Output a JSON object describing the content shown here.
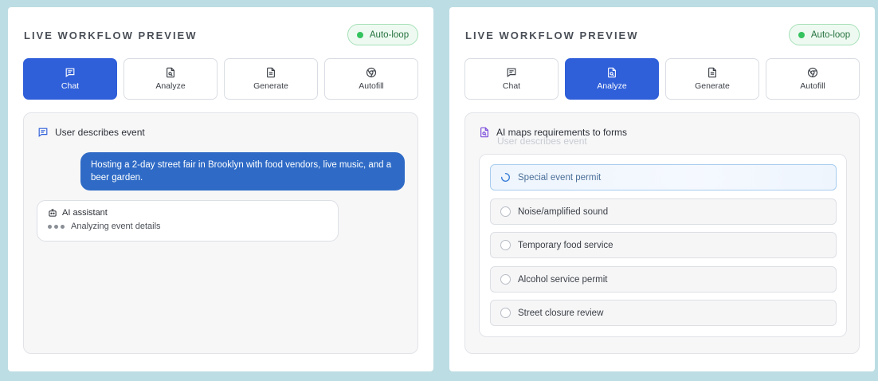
{
  "panels": [
    {
      "title": "LIVE WORKFLOW PREVIEW",
      "badge": "Auto-loop",
      "tabs": [
        {
          "label": "Chat"
        },
        {
          "label": "Analyze"
        },
        {
          "label": "Generate"
        },
        {
          "label": "Autofill"
        }
      ],
      "active_tab": "Chat",
      "step_title": "User describes event",
      "user_message": "Hosting a 2-day street fair in Brooklyn with food vendors, live music, and a beer garden.",
      "assistant_name": "AI assistant",
      "assistant_status": "Analyzing event details"
    },
    {
      "title": "LIVE WORKFLOW PREVIEW",
      "badge": "Auto-loop",
      "tabs": [
        {
          "label": "Chat"
        },
        {
          "label": "Analyze"
        },
        {
          "label": "Generate"
        },
        {
          "label": "Autofill"
        }
      ],
      "active_tab": "Analyze",
      "step_title": "AI maps requirements to forms",
      "previous_step_ghost": "User describes event",
      "requirements": [
        {
          "label": "Special event permit",
          "state": "in-progress"
        },
        {
          "label": "Noise/amplified sound",
          "state": "pending"
        },
        {
          "label": "Temporary food service",
          "state": "pending"
        },
        {
          "label": "Alcohol service permit",
          "state": "pending"
        },
        {
          "label": "Street closure review",
          "state": "pending"
        }
      ]
    }
  ],
  "colors": {
    "background": "#bcdde3",
    "accent": "#2f5fd9",
    "user_bubble": "#2f6bc6",
    "badge_green": "#34c35f",
    "analyze_icon": "#7c4ddb"
  },
  "icons": {
    "chat": "chat-icon",
    "analyze": "document-search-icon",
    "generate": "document-icon",
    "autofill": "chrome-icon",
    "assistant": "robot-icon",
    "in_progress": "spinner-icon"
  }
}
